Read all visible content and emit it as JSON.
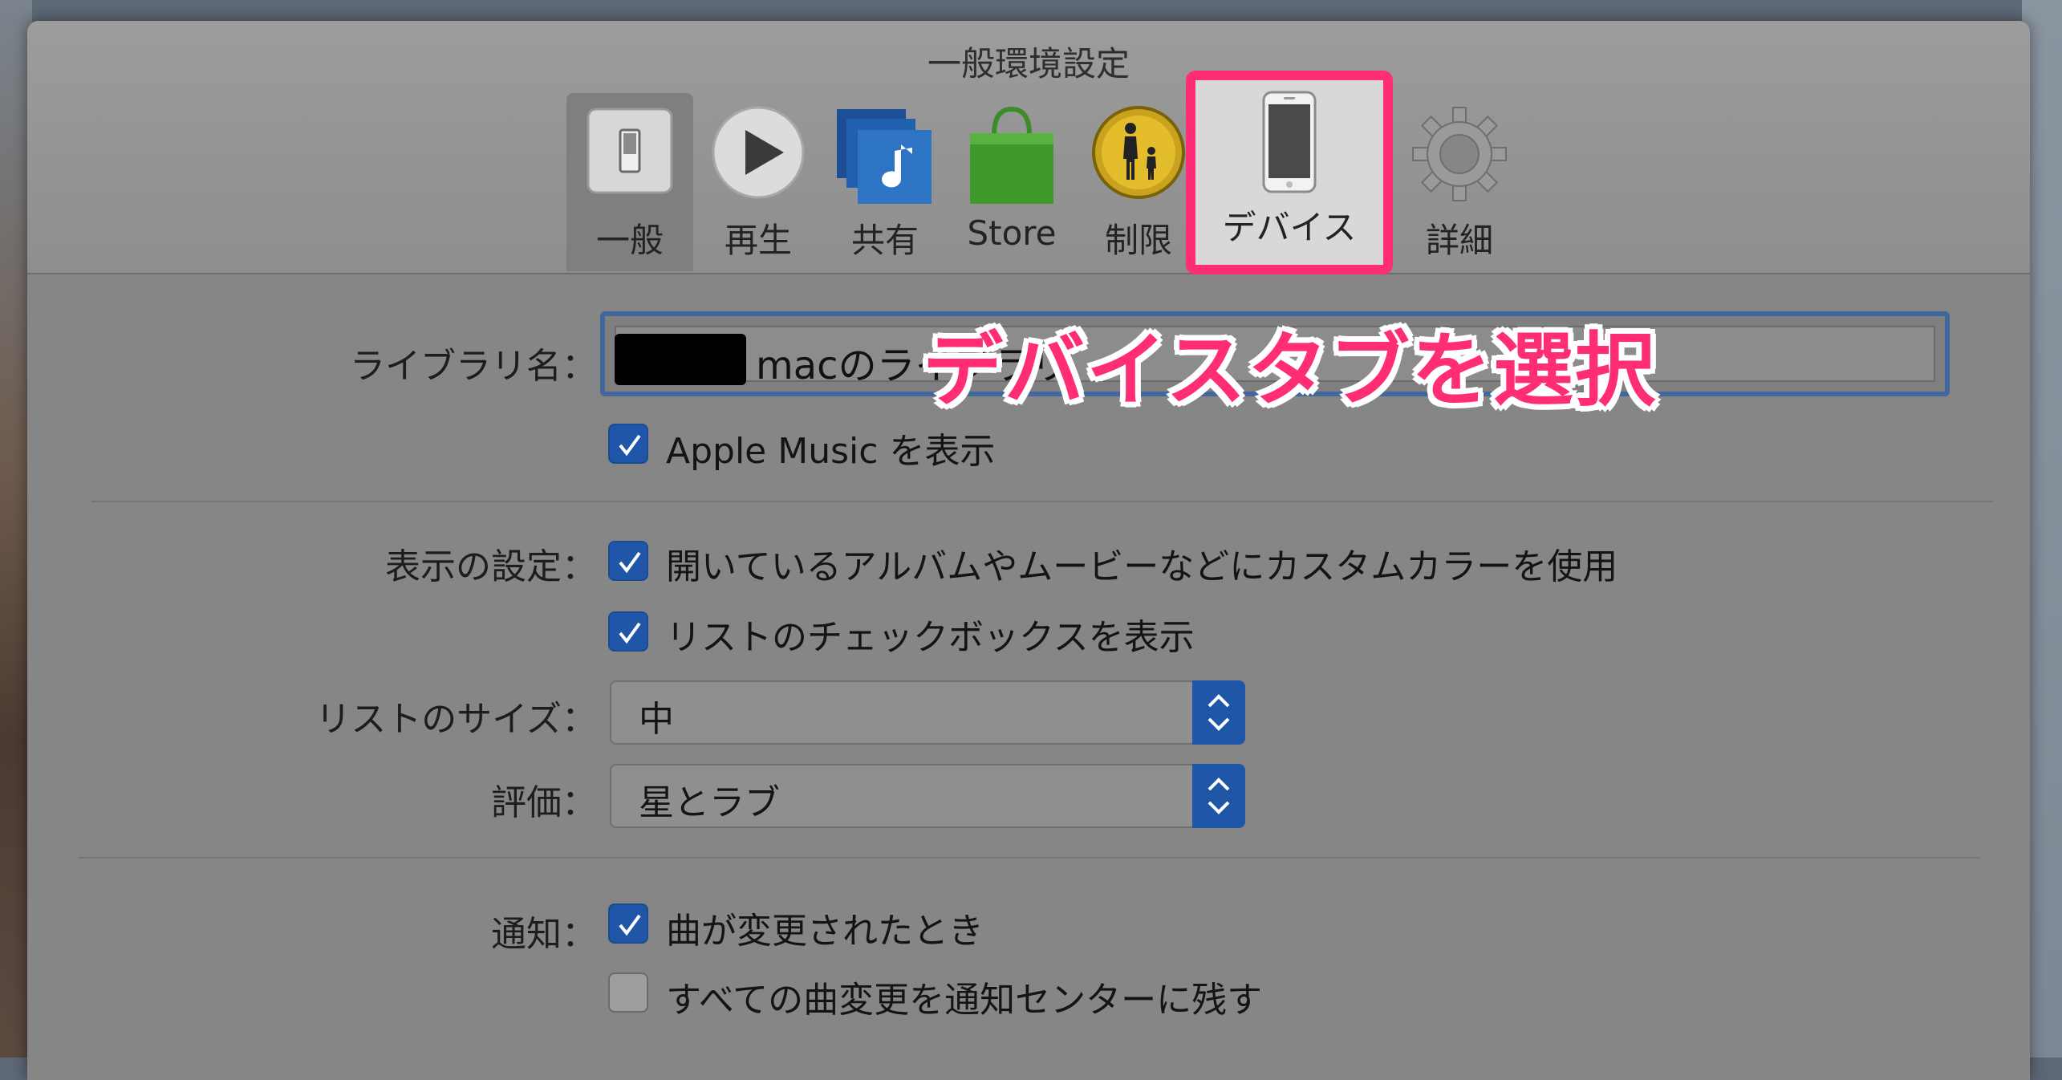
{
  "window": {
    "title": "一般環境設定"
  },
  "tabs": [
    {
      "id": "general",
      "label": "一般",
      "icon": "switch-icon",
      "selected": true
    },
    {
      "id": "playback",
      "label": "再生",
      "icon": "play-icon"
    },
    {
      "id": "sharing",
      "label": "共有",
      "icon": "music-note-icon"
    },
    {
      "id": "store",
      "label": "Store",
      "icon": "shopping-bag-icon"
    },
    {
      "id": "restrictions",
      "label": "制限",
      "icon": "parental-icon"
    },
    {
      "id": "devices",
      "label": "デバイス",
      "icon": "iphone-icon"
    },
    {
      "id": "advanced",
      "label": "詳細",
      "icon": "gear-icon"
    }
  ],
  "library": {
    "label": "ライブラリ名：",
    "value": "macのライブラリ"
  },
  "apple_music": {
    "label": "Apple Music を表示",
    "checked": true
  },
  "display": {
    "label": "表示の設定：",
    "options": [
      {
        "label": "開いているアルバムやムービーなどにカスタムカラーを使用",
        "checked": true
      },
      {
        "label": "リストのチェックボックスを表示",
        "checked": true
      }
    ]
  },
  "list_size": {
    "label": "リストのサイズ：",
    "value": "中"
  },
  "rating": {
    "label": "評価：",
    "value": "星とラブ"
  },
  "notifications": {
    "label": "通知：",
    "options": [
      {
        "label": "曲が変更されたとき",
        "checked": true
      },
      {
        "label": "すべての曲変更を通知センターに残す",
        "checked": false
      }
    ]
  },
  "annotation": {
    "text": "デバイスタブを選択",
    "color": "#ff2c76"
  },
  "colors": {
    "accent": "#1f56a8",
    "highlight": "#ff2c76"
  }
}
